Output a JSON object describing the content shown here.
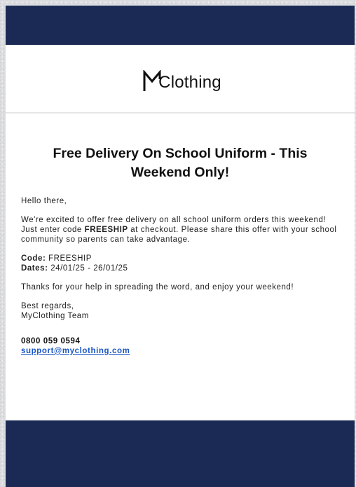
{
  "brand": {
    "logo_text": "Clothing",
    "navy": "#1b2a55"
  },
  "email": {
    "headline": "Free Delivery On School Uniform - This Weekend Only!",
    "greeting": "Hello there,",
    "intro_1": "We're excited to offer free delivery on all school uniform orders this weekend! Just enter code ",
    "intro_code": "FREESHIP",
    "intro_2": " at checkout. Please share this offer with your school community so parents can take advantage.",
    "code_label": "Code:",
    "code_value": " FREESHIP",
    "dates_label": "Dates:",
    "dates_value": " 24/01/25 - 26/01/25",
    "thanks": "Thanks for your help in spreading the word, and enjoy your weekend!",
    "signoff": "Best regards,",
    "signature": "MyClothing Team",
    "phone": "0800 059 0594",
    "support_email": "support@myclothing.com"
  }
}
